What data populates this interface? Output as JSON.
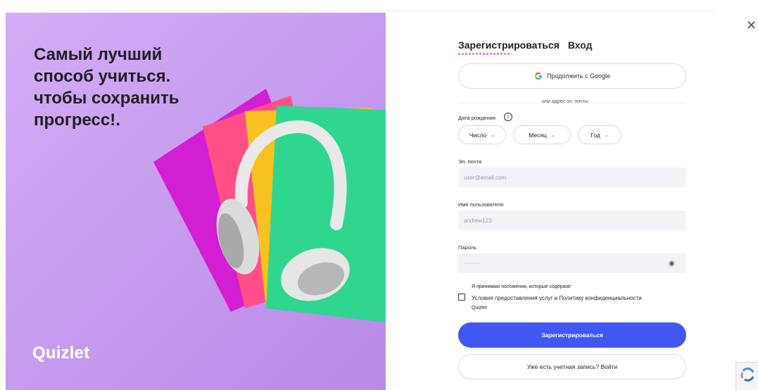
{
  "promo": {
    "title_lines": [
      "Самый лучший",
      "способ учиться.",
      "чтобы сохранить",
      "прогресс!."
    ],
    "logo": "Quizlet"
  },
  "tabs": {
    "signup": "Зарегистрироваться",
    "login": "Вход"
  },
  "google": {
    "label": "Продолжить с Google"
  },
  "divider": "или адрес эл. почты",
  "dob": {
    "label": "Дата рождения",
    "day": "Число",
    "month": "Месяц",
    "year": "Год"
  },
  "email": {
    "label": "Эл. почта",
    "placeholder": "user@email.com"
  },
  "username": {
    "label": "Имя пользователя",
    "placeholder": "andrew123"
  },
  "password": {
    "label": "Пароль",
    "placeholder": "·········"
  },
  "terms": {
    "line1": "Я принимаю положения, которые содержат",
    "tos": "Условия предоставления услуг",
    "and": "и",
    "privacy": "Политику конфиденциальности",
    "brand": "Quizlet"
  },
  "buttons": {
    "signup": "Зарегистрироваться",
    "login": "Уже есть учетная запись? Войти"
  },
  "colors": {
    "promo_bg": "#c79ff0",
    "accent": "#4256f4"
  }
}
